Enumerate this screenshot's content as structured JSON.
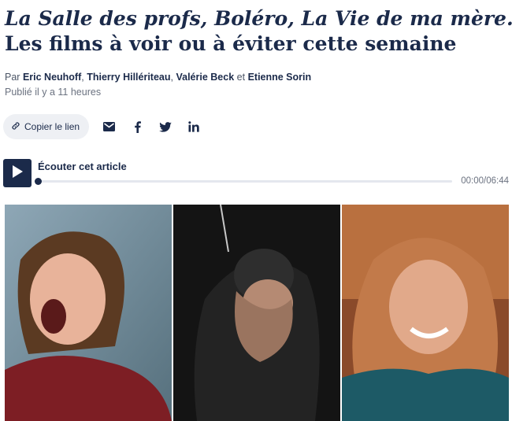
{
  "article": {
    "title_line1": "La Salle des profs, Boléro, La Vie de ma mère...",
    "title_line2": "Les films à voir ou à éviter cette semaine",
    "by_prefix": "Par",
    "authors": [
      "Eric Neuhoff",
      "Thierry Hillériteau",
      "Valérie Beck",
      "Etienne Sorin"
    ],
    "sep_comma": ",",
    "sep_and": "et",
    "published": "Publié il y a 11 heures"
  },
  "share": {
    "copy_label": "Copier le lien",
    "icons": [
      "link-icon",
      "email-icon",
      "facebook-icon",
      "twitter-icon",
      "linkedin-icon"
    ]
  },
  "player": {
    "label": "Écouter cet article",
    "time": "00:00/06:44",
    "progress": 0
  },
  "colors": {
    "brand_navy": "#1b2a4a",
    "button_bg": "#eef0f4",
    "track": "#e4e7ee"
  }
}
